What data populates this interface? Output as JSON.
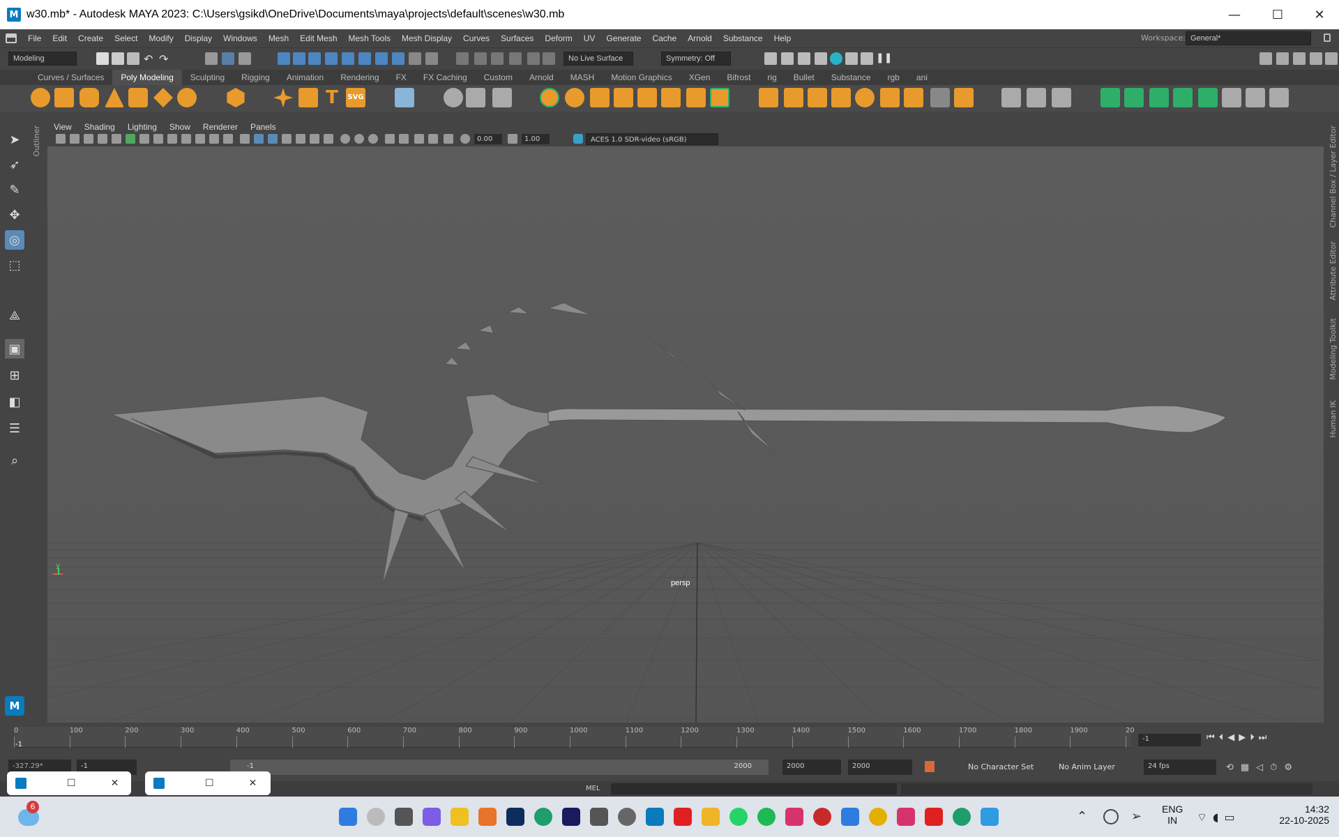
{
  "window": {
    "title": "w30.mb* - Autodesk MAYA 2023: C:\\Users\\gsikd\\OneDrive\\Documents\\maya\\projects\\default\\scenes\\w30.mb",
    "logo_letter": "M",
    "minimize": "—",
    "maximize": "☐",
    "close": "✕"
  },
  "menubar": {
    "items": [
      "File",
      "Edit",
      "Create",
      "Select",
      "Modify",
      "Display",
      "Windows",
      "Mesh",
      "Edit Mesh",
      "Mesh Tools",
      "Mesh Display",
      "Curves",
      "Surfaces",
      "Deform",
      "UV",
      "Generate",
      "Cache",
      "Arnold",
      "Substance",
      "Help"
    ],
    "workspace_label": "Workspace:",
    "workspace_value": "General*"
  },
  "statusline": {
    "menuset": "Modeling",
    "live_surface": "No Live Surface",
    "symmetry": "Symmetry: Off"
  },
  "shelf": {
    "tabs": [
      "Curves / Surfaces",
      "Poly Modeling",
      "Sculpting",
      "Rigging",
      "Animation",
      "Rendering",
      "FX",
      "FX Caching",
      "Custom",
      "Arnold",
      "MASH",
      "Motion Graphics",
      "XGen",
      "Bifrost",
      "rig",
      "Bullet",
      "Substance",
      "rgb",
      "ani"
    ],
    "active_tab": "Poly Modeling",
    "text_icon": "T",
    "svg_icon": "SVG"
  },
  "panel": {
    "menus": [
      "View",
      "Shading",
      "Lighting",
      "Show",
      "Renderer",
      "Panels"
    ],
    "field_a": "0.00",
    "field_b": "1.00",
    "colorspace": "ACES 1.0 SDR-video (sRGB)",
    "camera_label": "persp",
    "axis_y": "y"
  },
  "side_tabs": {
    "outliner": "Outliner",
    "channel_box": "Channel Box / Layer Editor",
    "attribute_editor": "Attribute Editor",
    "modeling_toolkit": "Modeling Toolkit",
    "human_ik": "Human IK"
  },
  "timeline": {
    "ticks": [
      "0",
      "100",
      "200",
      "300",
      "400",
      "500",
      "600",
      "700",
      "800",
      "900",
      "1000",
      "1100",
      "1200",
      "1300",
      "1400",
      "1500",
      "1600",
      "1700",
      "1800",
      "1900",
      "20"
    ],
    "current_frame_marker": "-1",
    "current_frame_field": "-1"
  },
  "range": {
    "readout": "-327.29*",
    "start": "-1",
    "slider_start": "-1",
    "slider_end": "2000",
    "end_a": "2000",
    "end_b": "2000",
    "character_set": "No Character Set",
    "anim_layer": "No Anim Layer",
    "fps": "24 fps"
  },
  "cmdline": {
    "label": "MEL"
  },
  "taskbar": {
    "notification_count": "6",
    "lang_top": "ENG",
    "lang_bottom": "IN",
    "time": "14:32",
    "date": "22-10-2025"
  },
  "colors": {
    "maya_blue": "#0a7bbd",
    "mesh_gray": "#8a8a8a",
    "grid_line": "#4a4a4a",
    "shelf_orange": "#e89a2c",
    "shelf_green": "#2fae6a"
  }
}
